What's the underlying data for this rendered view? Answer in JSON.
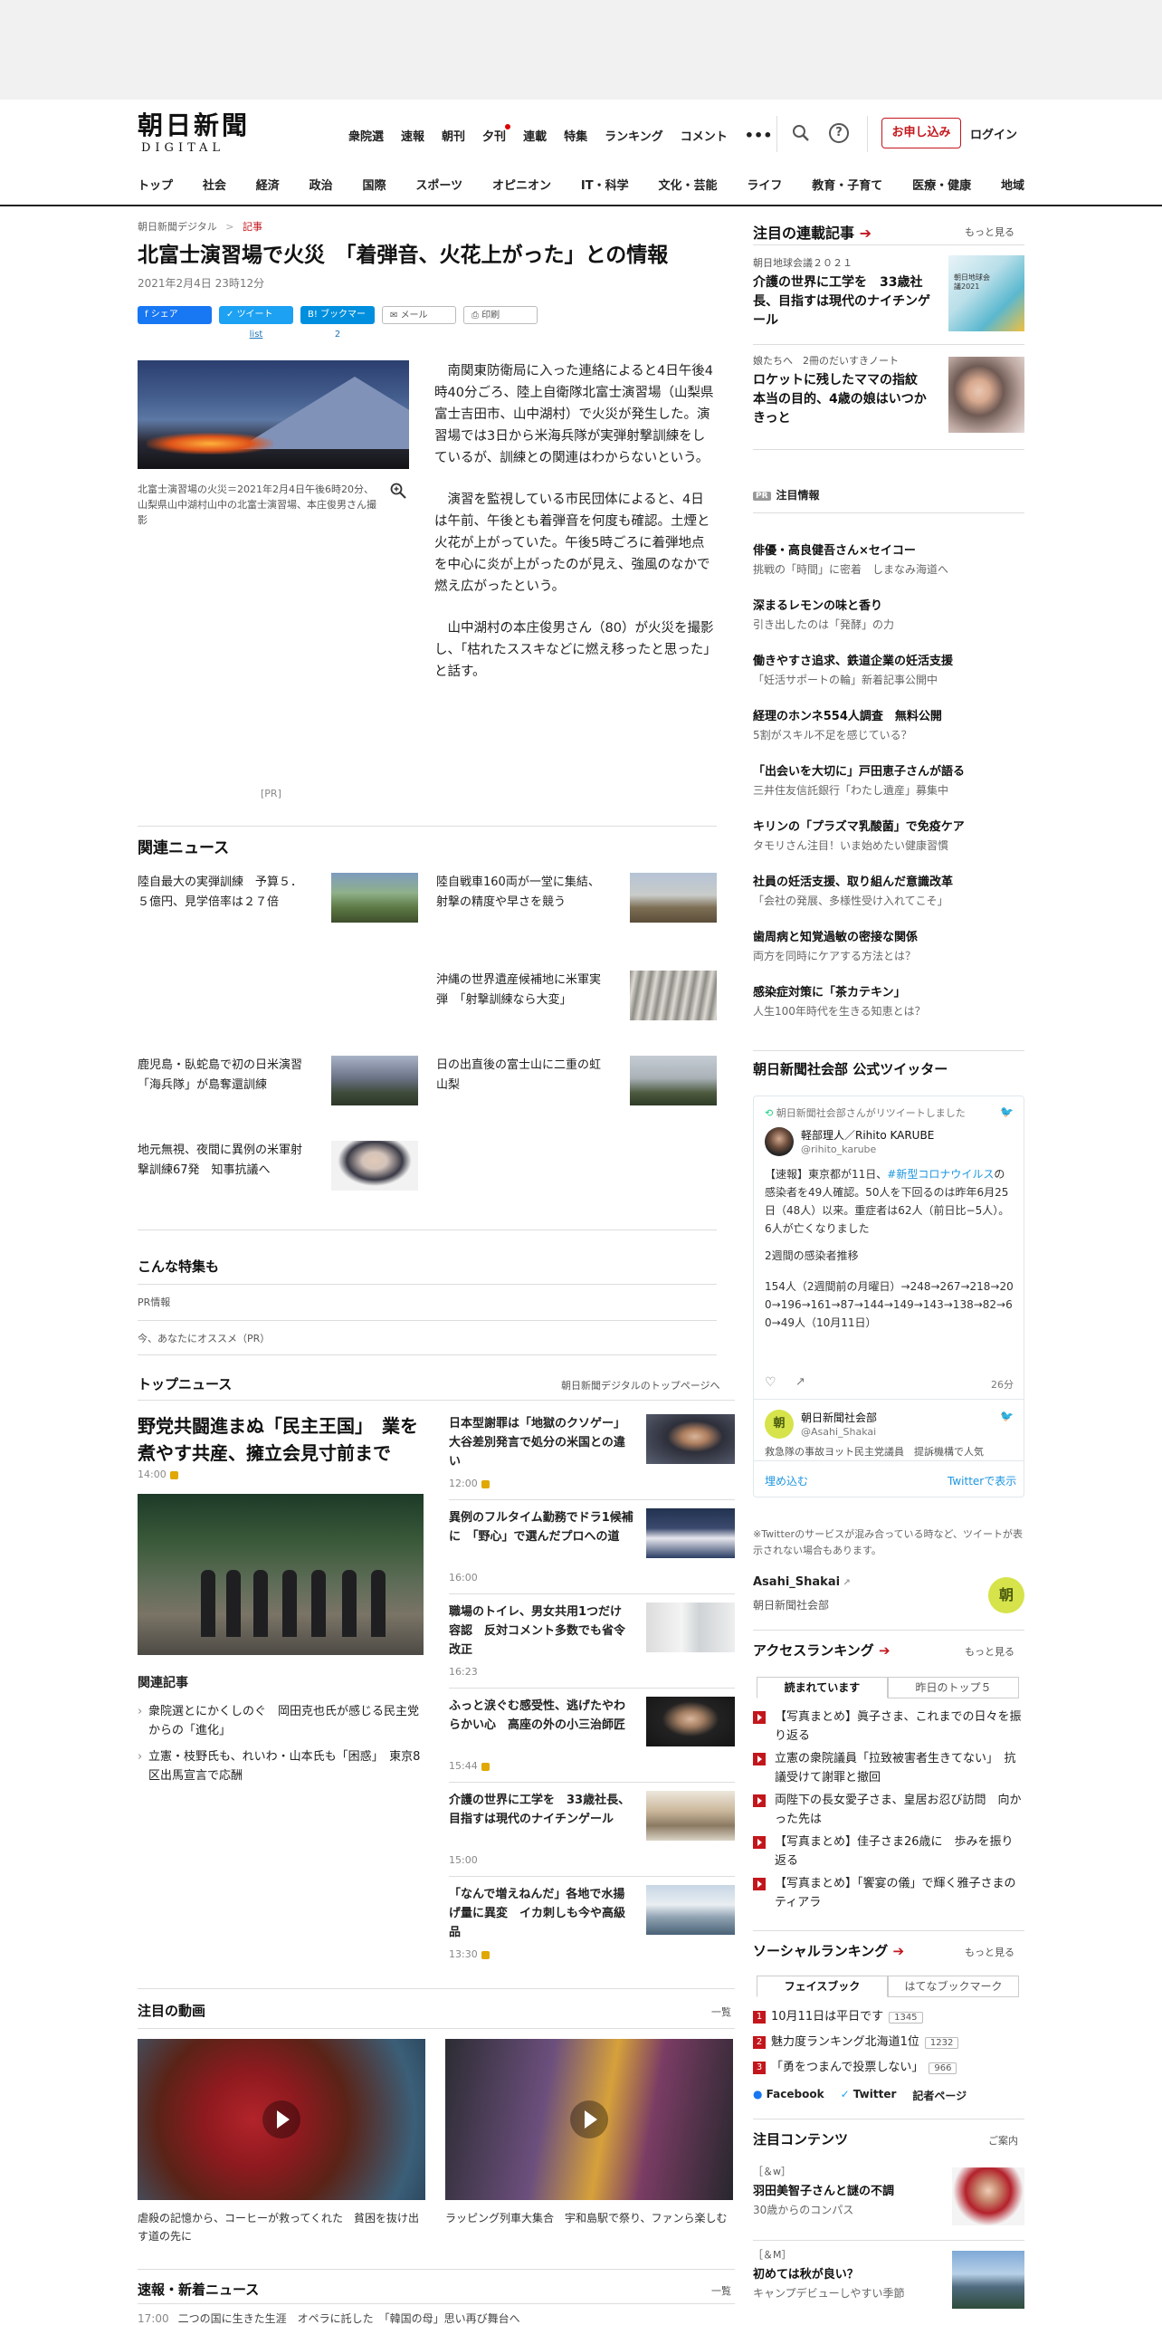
{
  "header": {
    "logo_jp": "朝日新聞",
    "logo_en": "DIGITAL",
    "top_nav": [
      "衆院選",
      "速報",
      "朝刊",
      "夕刊",
      "連載",
      "特集",
      "ランキング",
      "コメント"
    ],
    "apply_label": "お申し込み",
    "login_label": "ログイン",
    "category_nav": [
      "トップ",
      "社会",
      "経済",
      "政治",
      "国際",
      "スポーツ",
      "オピニオン",
      "IT・科学",
      "文化・芸能",
      "ライフ",
      "教育・子育て",
      "医療・健康",
      "地域"
    ]
  },
  "article": {
    "breadcrumb_home": "朝日新聞デジタル",
    "breadcrumb_sep": ">",
    "breadcrumb_current": "記事",
    "title": "北富士演習場で火災　「着弾音、火花上がった」との情報",
    "date": "2021年2月4日 23時12分",
    "share": {
      "facebook": "シェア",
      "tweet": "ツイート",
      "tweet_count": "list",
      "bookmark": "ブックマーク",
      "bookmark_count": "2",
      "mail": "メール",
      "print": "印刷"
    },
    "photo_caption": "北富士演習場の火災＝2021年2月4日午後6時20分、山梨県山中湖村山中の北富士演習場、本庄俊男さん撮影",
    "paragraphs": [
      "南関東防衛局に入った連絡によると4日午後4時40分ごろ、陸上自衛隊北富士演習場（山梨県富士吉田市、山中湖村）で火災が発生した。演習場では3日から米海兵隊が実弾射撃訓練をしているが、訓練との関連はわからないという。",
      "演習を監視している市民団体によると、4日は午前、午後とも着弾音を何度も確認。土煙と火花が上がっていた。午後5時ごろに着弾地点を中心に炎が上がったのが見え、強風のなかで燃え広がったという。",
      "山中湖村の本庄俊男さん（80）が火災を撮影し、「枯れたススキなどに燃え移ったと思った」と話す。"
    ],
    "pr_mark": "[PR]"
  },
  "related": {
    "title": "関連ニュース",
    "items": [
      "陸自最大の実弾訓練　予算５．５億円、見学倍率は２７倍",
      "陸自戦車160両が一堂に集結、射撃の精度や早さを競う",
      "沖縄の世界遺産候補地に米軍実弾　「射撃訓練なら大変」",
      "鹿児島・臥蛇島で初の日米演習　「海兵隊」が島奪還訓練",
      "日の出直後の富士山に二重の虹　山梨",
      "地元無視、夜間に異例の米軍射撃訓練67発　知事抗議へ"
    ]
  },
  "konna": {
    "title": "こんな特集も",
    "pr_info": "PR情報",
    "recommend": "今、あなたにオススメ（PR）"
  },
  "top_news": {
    "title": "トップニュース",
    "link": "朝日新聞デジタルのトップページへ",
    "lead_title": "野党共闘進まぬ「民主王国」　業を煮やす共産、擁立会見寸前まで",
    "lead_time": "14:00",
    "kanren_title": "関連記事",
    "kanren": [
      "衆院選とにかくしのぐ　岡田克也氏が感じる民主党からの「進化」",
      "立憲・枝野氏も、れいわ・山本氏も「困惑」　東京8区出馬宣言で応酬"
    ],
    "items": [
      {
        "title": "日本型謝罪は「地獄のクソゲー」　大谷差別発言で処分の米国との違い",
        "time": "12:00"
      },
      {
        "title": "異例のフルタイム勤務でドラ1候補に　「野心」で選んだプロへの道",
        "time": "16:00"
      },
      {
        "title": "職場のトイレ、男女共用1つだけ容認　反対コメント多数でも省令改正",
        "time": "16:23"
      },
      {
        "title": "ふっと涙ぐむ感受性、逃げたやわらかい心　高座の外の小三治師匠",
        "time": "15:44"
      },
      {
        "title": "介護の世界に工学を　33歳社長、目指すは現代のナイチンゲール",
        "time": "15:00"
      },
      {
        "title": "「なんで増えねんだ」各地で水揚げ量に異変　イカ刺しも今や高級品",
        "time": "13:30"
      }
    ]
  },
  "videos": {
    "title": "注目の動画",
    "more": "一覧",
    "items": [
      "虐殺の記憶から、コーヒーが救ってくれた　貧困を抜け出す道の先に",
      "ラッピング列車大集合　宇和島駅で祭り、ファンら楽しむ"
    ]
  },
  "sokuho": {
    "title": "速報・新着ニュース",
    "more": "一覧",
    "first_time": "17:00",
    "first_text": "二つの国に生きた生涯　オペラに託した　「韓国の母」思い再び舞台へ"
  },
  "sidebar": {
    "rensai_title": "注目の連載記事",
    "rensai_more": "もっと見る",
    "rensai": [
      {
        "label": "朝日地球会議２０２１",
        "title": "介護の世界に工学を　33歳社長、目指すは現代のナイチンゲール",
        "thumb_text": "朝日地球会議2021"
      },
      {
        "label": "娘たちへ　2冊のだいすきノート",
        "title": "ロケットに残したママの指紋　本当の目的、4歳の娘はいつかきっと"
      }
    ],
    "pr_title": "注目情報",
    "pr_badge": "PR",
    "pr_items": [
      {
        "t": "俳優・高良健吾さん×セイコー",
        "s": "挑戦の「時間」に密着　しまなみ海道へ"
      },
      {
        "t": "深まるレモンの味と香り",
        "s": "引き出したのは「発酵」の力"
      },
      {
        "t": "働きやすさ追求、鉄道企業の妊活支援",
        "s": "「妊活サポートの輪」新着記事公開中"
      },
      {
        "t": "経理のホンネ554人調査　無料公開",
        "s": "5割がスキル不足を感じている？"
      },
      {
        "t": "「出会いを大切に」戸田恵子さんが語る",
        "s": "三井住友信託銀行「わたし遺産」募集中"
      },
      {
        "t": "キリンの「プラズマ乳酸菌」で免疫ケア",
        "s": "タモリさん注目！いま始めたい健康習慣"
      },
      {
        "t": "社員の妊活支援、取り組んだ意識改革",
        "s": "「会社の発展、多様性受け入れてこそ」"
      },
      {
        "t": "歯周病と知覚過敏の密接な関係",
        "s": "両方を同時にケアする方法とは？"
      },
      {
        "t": "感染症対策に「茶カテキン」",
        "s": "人生100年時代を生きる知恵とは？"
      }
    ],
    "twitter_title": "朝日新聞社会部 公式ツイッター",
    "twitter": {
      "retweet": "朝日新聞社会部さんがリツイートしました",
      "name": "軽部理人／Rihito KARUBE",
      "handle": "@rihito_karube",
      "text_pre": "【速報】東京都が11日、",
      "hashtag": "#新型コロナウイルス",
      "text_post": "の感染者を49人確認。50人を下回るのは昨年6月25日（48人）以来。重症者は62人（前日比−5人）。6人が亡くなりました",
      "line2": "2週間の感染者推移",
      "line3": "154人（2週間前の月曜日）→248→267→218→200→196→161→87→144→149→143→138→82→60→49人（10月11日）",
      "time": "26分",
      "next_name": "朝日新聞社会部",
      "next_handle": "@Asahi_Shakai",
      "next_text": "救急隊の事故ヨット民主党議員　提訴機構で人気",
      "embed": "埋め込む",
      "view": "Twitterで表示",
      "avatar_text": "朝"
    },
    "twitter_note": "※Twitterのサービスが混み合っている時など、ツイートが表示されない場合もあります。",
    "account_name": "Asahi_Shakai",
    "account_desc": "朝日新聞社会部",
    "account_avatar": "朝",
    "access_title": "アクセスランキング",
    "access_more": "もっと見る",
    "access_tabs": [
      "読まれています",
      "昨日のトップ５"
    ],
    "access_items": [
      "【写真まとめ】眞子さま、これまでの日々を振り返る",
      "立憲の衆院議員「拉致被害者生きてない」　抗議受けて謝罪と撤回",
      "両陛下の長女愛子さま、皇居お忍び訪問　向かった先は",
      "【写真まとめ】佳子さま26歳に　歩みを振り返る",
      "【写真まとめ】「饗宴の儀」で輝く雅子さまのティアラ"
    ],
    "social_title": "ソーシャルランキング",
    "social_more": "もっと見る",
    "social_tabs": [
      "フェイスブック",
      "はてなブックマーク"
    ],
    "social_items": [
      {
        "n": "1",
        "t": "10月11日は平日です",
        "c": "1345"
      },
      {
        "n": "2",
        "t": "魅力度ランキング北海道1位",
        "c": "1232"
      },
      {
        "n": "3",
        "t": "「勇をつまんで投票しない」",
        "c": "966"
      }
    ],
    "social_links": [
      "Facebook",
      "Twitter",
      "記者ページ"
    ],
    "contents_title": "注目コンテンツ",
    "contents_more": "ご案内",
    "contents": [
      {
        "label": "［＆w］",
        "t": "羽田美智子さんと謎の不調",
        "s": "30歳からのコンパス"
      },
      {
        "label": "［＆M］",
        "t": "初めては秋が良い？",
        "s": "キャンプデビューしやすい季節"
      }
    ]
  }
}
